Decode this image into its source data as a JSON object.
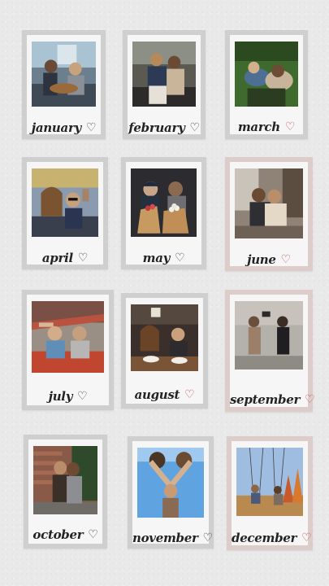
{
  "months": [
    {
      "label": "january",
      "photo_description": "two friends sitting on a couch playing guitar",
      "heart": "♡"
    },
    {
      "label": "february",
      "photo_description": "two friends sitting on steps outdoors",
      "heart": "♡"
    },
    {
      "label": "march",
      "photo_description": "friends lying on grass together",
      "heart": "♡"
    },
    {
      "label": "april",
      "photo_description": "group selfie with sunglasses at a fair",
      "heart": "♡"
    },
    {
      "label": "may",
      "photo_description": "two friends holding flower bouquets",
      "heart": "♡"
    },
    {
      "label": "june",
      "photo_description": "friends hugging in a room",
      "heart": "♡"
    },
    {
      "label": "july",
      "photo_description": "friends on an amusement park ride",
      "heart": "♡"
    },
    {
      "label": "august",
      "photo_description": "friends eating noodles at a table",
      "heart": "♡"
    },
    {
      "label": "september",
      "photo_description": "two friends posing on a street",
      "heart": "♡"
    },
    {
      "label": "october",
      "photo_description": "two friends hugging by a brick wall",
      "heart": "♡"
    },
    {
      "label": "november",
      "photo_description": "friends photographed from below against blue sky",
      "heart": "♡"
    },
    {
      "label": "december",
      "photo_description": "two friends on swings in autumn",
      "heart": "♡"
    }
  ],
  "colors": {
    "background": "#e9e9e9",
    "card_gray": "#cfcfcf",
    "card_pink": "#dccdcb",
    "frame": "#f6f6f6",
    "heart_red": "#c0504a"
  }
}
